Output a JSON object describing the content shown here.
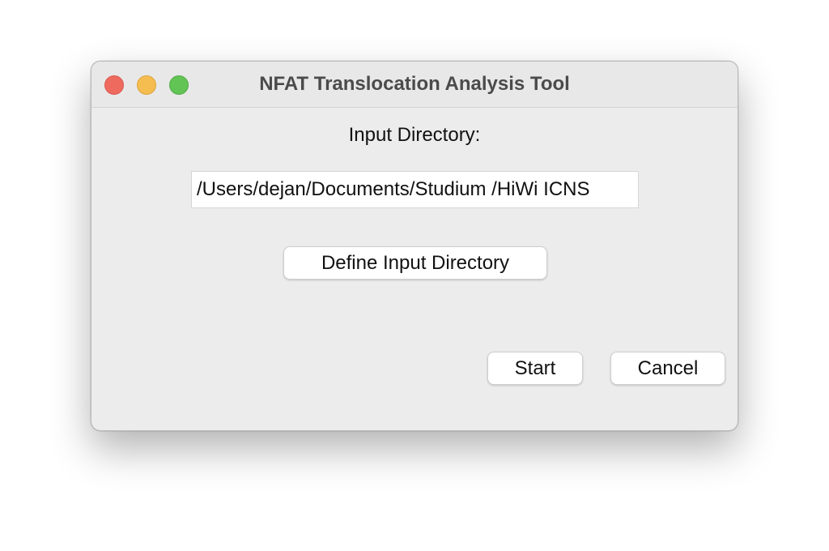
{
  "window": {
    "title": "NFAT Translocation Analysis Tool",
    "controls": {
      "close_color": "#ee6a5f",
      "minimize_color": "#f5bd4f",
      "zoom_color": "#61c454"
    }
  },
  "form": {
    "input_label": "Input Directory:",
    "input_value": "/Users/dejan/Documents/Studium /HiWi ICNS",
    "define_button_label": "Define Input Directory"
  },
  "actions": {
    "start_label": "Start",
    "cancel_label": "Cancel"
  }
}
